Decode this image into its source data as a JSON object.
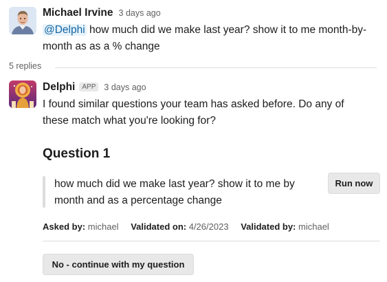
{
  "messages": [
    {
      "author": "Michael Irvine",
      "time": "3 days ago",
      "mention": "@Delphi",
      "text": " how much did we make last year? show it to me month-by-month as as a % change"
    },
    {
      "author": "Delphi",
      "badge": "APP",
      "time": "3 days ago",
      "text": "I found similar questions your team has asked before. Do any of these match what you're looking for?"
    }
  ],
  "thread": {
    "replies_label": "5 replies"
  },
  "question": {
    "title": "Question 1",
    "text": "how much did we make last year? show it to me by month and as a percentage change",
    "run_label": "Run now",
    "asked_by_label": "Asked by:",
    "asked_by": "michael",
    "validated_on_label": "Validated on:",
    "validated_on": "4/26/2023",
    "validated_by_label": "Validated by:",
    "validated_by": "michael"
  },
  "actions": {
    "decline_label": "No - continue with my question"
  },
  "colors": {
    "mention_bg": "#e8f3fb",
    "mention_text": "#1264a3",
    "button_bg": "#e8e8e8",
    "muted_text": "#616061"
  }
}
